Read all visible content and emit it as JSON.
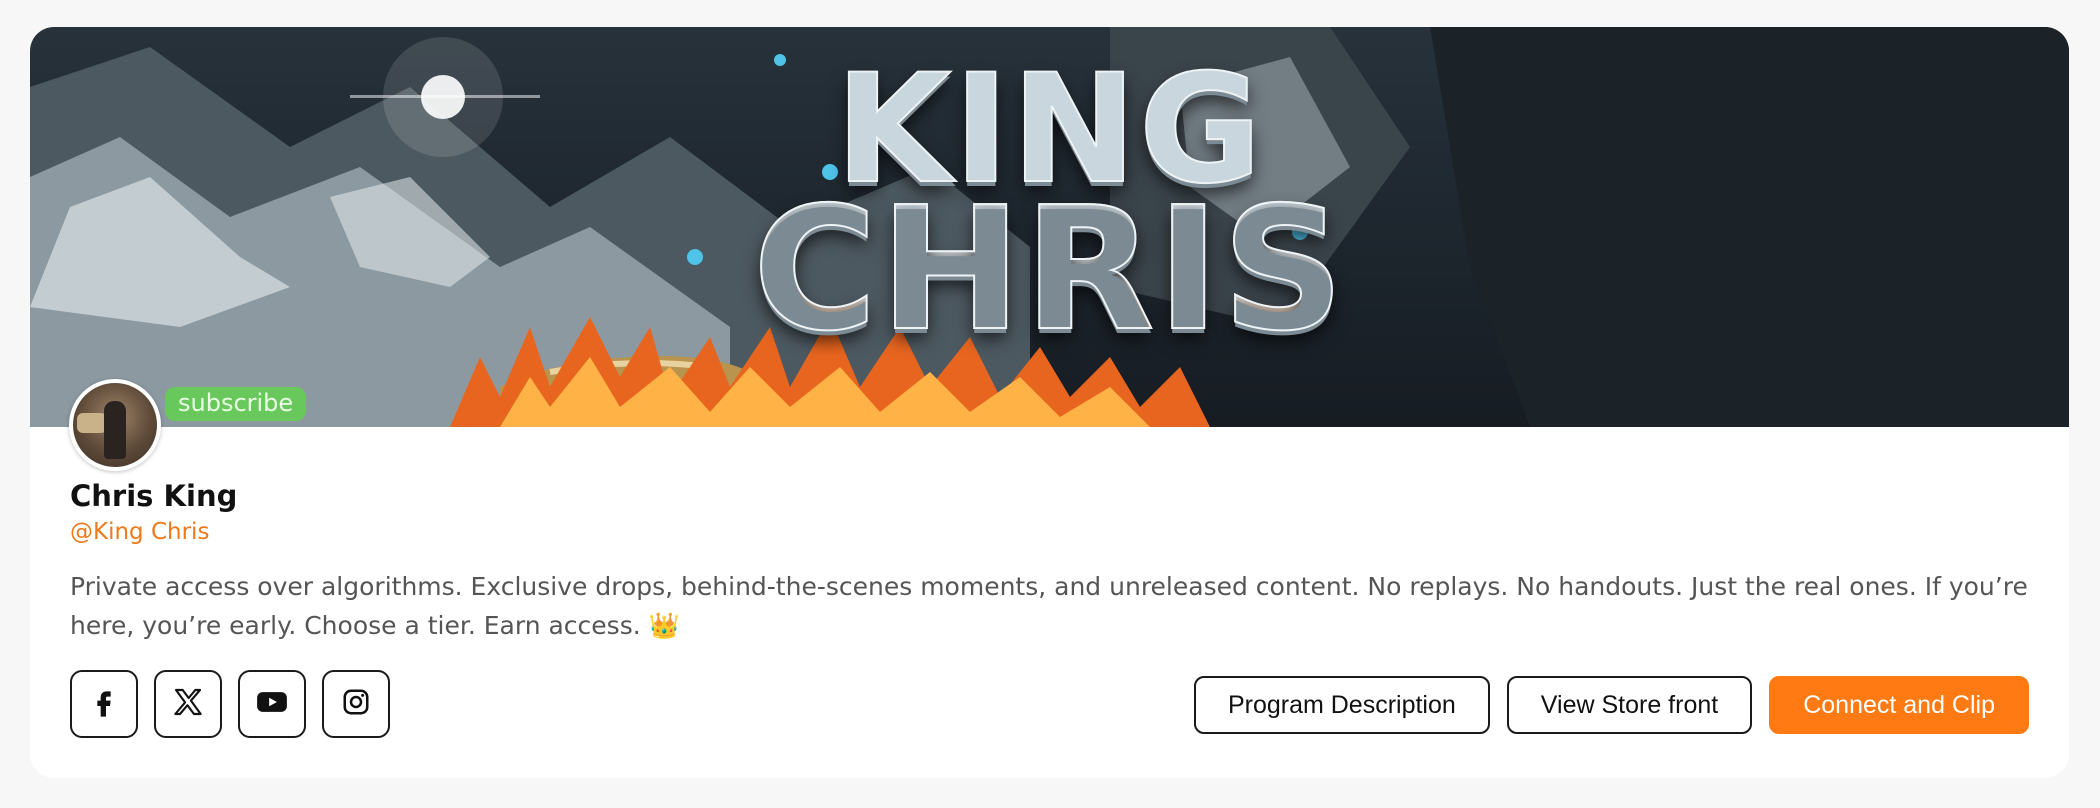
{
  "profile": {
    "name": "Chris King",
    "handle": "@King Chris",
    "bio": "Private access over algorithms. Exclusive drops, behind-the-scenes moments, and unreleased content. No replays. No handouts. Just the real ones. If you’re here, you’re early. Choose a tier. Earn access. 👑"
  },
  "banner": {
    "line1": "KING",
    "line2": "CHRIS",
    "subscribe_label": "subscribe"
  },
  "socials": [
    {
      "icon": "facebook-icon"
    },
    {
      "icon": "x-icon"
    },
    {
      "icon": "youtube-icon"
    },
    {
      "icon": "instagram-icon"
    }
  ],
  "actions": {
    "program_description": "Program Description",
    "view_store_front": "View Store front",
    "connect_and_clip": "Connect and Clip"
  },
  "colors": {
    "accent": "#ff7a12",
    "handle": "#ec7a1c",
    "subscribe": "#69c85c"
  }
}
